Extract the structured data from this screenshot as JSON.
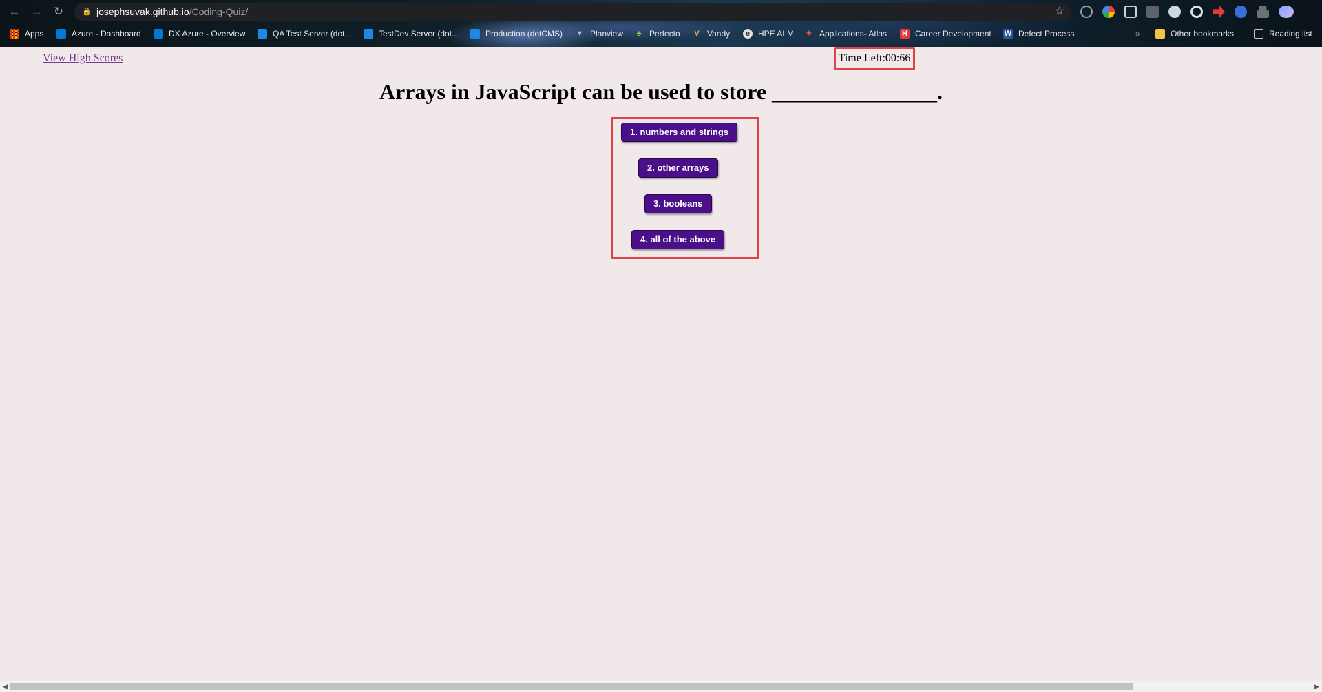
{
  "browser": {
    "url_host": "josephsuvak.github.io",
    "url_path": "/Coding-Quiz/",
    "icons": {
      "back": "arrow-left-icon",
      "forward": "arrow-right-icon",
      "reload": "reload-icon",
      "lock": "lock-icon",
      "bookmark_star": "star-icon"
    },
    "bookmarks": [
      {
        "label": "Apps",
        "icon": "apps-grid-icon"
      },
      {
        "label": "Azure - Dashboard",
        "icon": "azure-devops-icon"
      },
      {
        "label": "DX Azure - Overview",
        "icon": "azure-devops-icon"
      },
      {
        "label": "QA Test Server (dot...",
        "icon": "dotcms-icon"
      },
      {
        "label": "TestDev Server (dot...",
        "icon": "dotcms-icon"
      },
      {
        "label": "Production (dotCMS)",
        "icon": "dotcms-icon"
      },
      {
        "label": "Planview",
        "icon": "planview-icon"
      },
      {
        "label": "Perfecto",
        "icon": "perfecto-icon"
      },
      {
        "label": "Vandy",
        "icon": "vandy-icon"
      },
      {
        "label": "HPE ALM",
        "icon": "hpe-alm-icon"
      },
      {
        "label": "Applications- Atlas",
        "icon": "atlas-icon"
      },
      {
        "label": "Career Development",
        "icon": "career-icon"
      },
      {
        "label": "Defect Process",
        "icon": "word-doc-icon"
      }
    ],
    "other_bookmarks": "Other bookmarks",
    "reading_list": "Reading list",
    "overflow": "»"
  },
  "quiz": {
    "high_scores_link": "View High Scores",
    "timer_text": "Time Left:00:66",
    "question": "Arrays in JavaScript can be used to store _______________.",
    "answers": [
      "1. numbers and strings",
      "2. other arrays",
      "3. booleans",
      "4. all of the above"
    ],
    "highlight_color": "#e0424a",
    "button_color": "#4b0f8a"
  }
}
